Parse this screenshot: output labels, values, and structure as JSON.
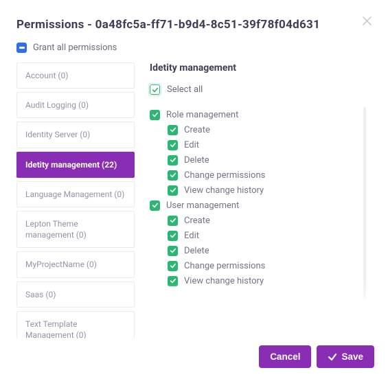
{
  "header": {
    "title": "Permissions - 0a48fc5a-ff71-b9d4-8c51-39f78f04d631"
  },
  "grant_all_label": "Grant all permissions",
  "tabs": [
    {
      "label": "Account (0)",
      "active": false
    },
    {
      "label": "Audit Logging (0)",
      "active": false
    },
    {
      "label": "Identity Server (0)",
      "active": false
    },
    {
      "label": "Idetity management (22)",
      "active": true
    },
    {
      "label": "Language Management (0)",
      "active": false
    },
    {
      "label": "Lepton Theme management (0)",
      "active": false
    },
    {
      "label": "MyProjectName (0)",
      "active": false
    },
    {
      "label": "Saas (0)",
      "active": false
    },
    {
      "label": "Text Template Management (0)",
      "active": false
    }
  ],
  "panel": {
    "title": "Idetity management",
    "select_all_label": "Select all",
    "tree": [
      {
        "label": "Role management",
        "level": 1,
        "checked": true
      },
      {
        "label": "Create",
        "level": 2,
        "checked": true
      },
      {
        "label": "Edit",
        "level": 2,
        "checked": true
      },
      {
        "label": "Delete",
        "level": 2,
        "checked": true
      },
      {
        "label": "Change permissions",
        "level": 2,
        "checked": true
      },
      {
        "label": "View change history",
        "level": 2,
        "checked": true
      },
      {
        "label": "User management",
        "level": 1,
        "checked": true
      },
      {
        "label": "Create",
        "level": 2,
        "checked": true
      },
      {
        "label": "Edit",
        "level": 2,
        "checked": true
      },
      {
        "label": "Delete",
        "level": 2,
        "checked": true
      },
      {
        "label": "Change permissions",
        "level": 2,
        "checked": true
      },
      {
        "label": "View change history",
        "level": 2,
        "checked": true
      }
    ]
  },
  "footer": {
    "cancel_label": "Cancel",
    "save_label": "Save"
  },
  "colors": {
    "accent": "#8a2db5",
    "check": "#2bb673",
    "info": "#2f6fed"
  }
}
